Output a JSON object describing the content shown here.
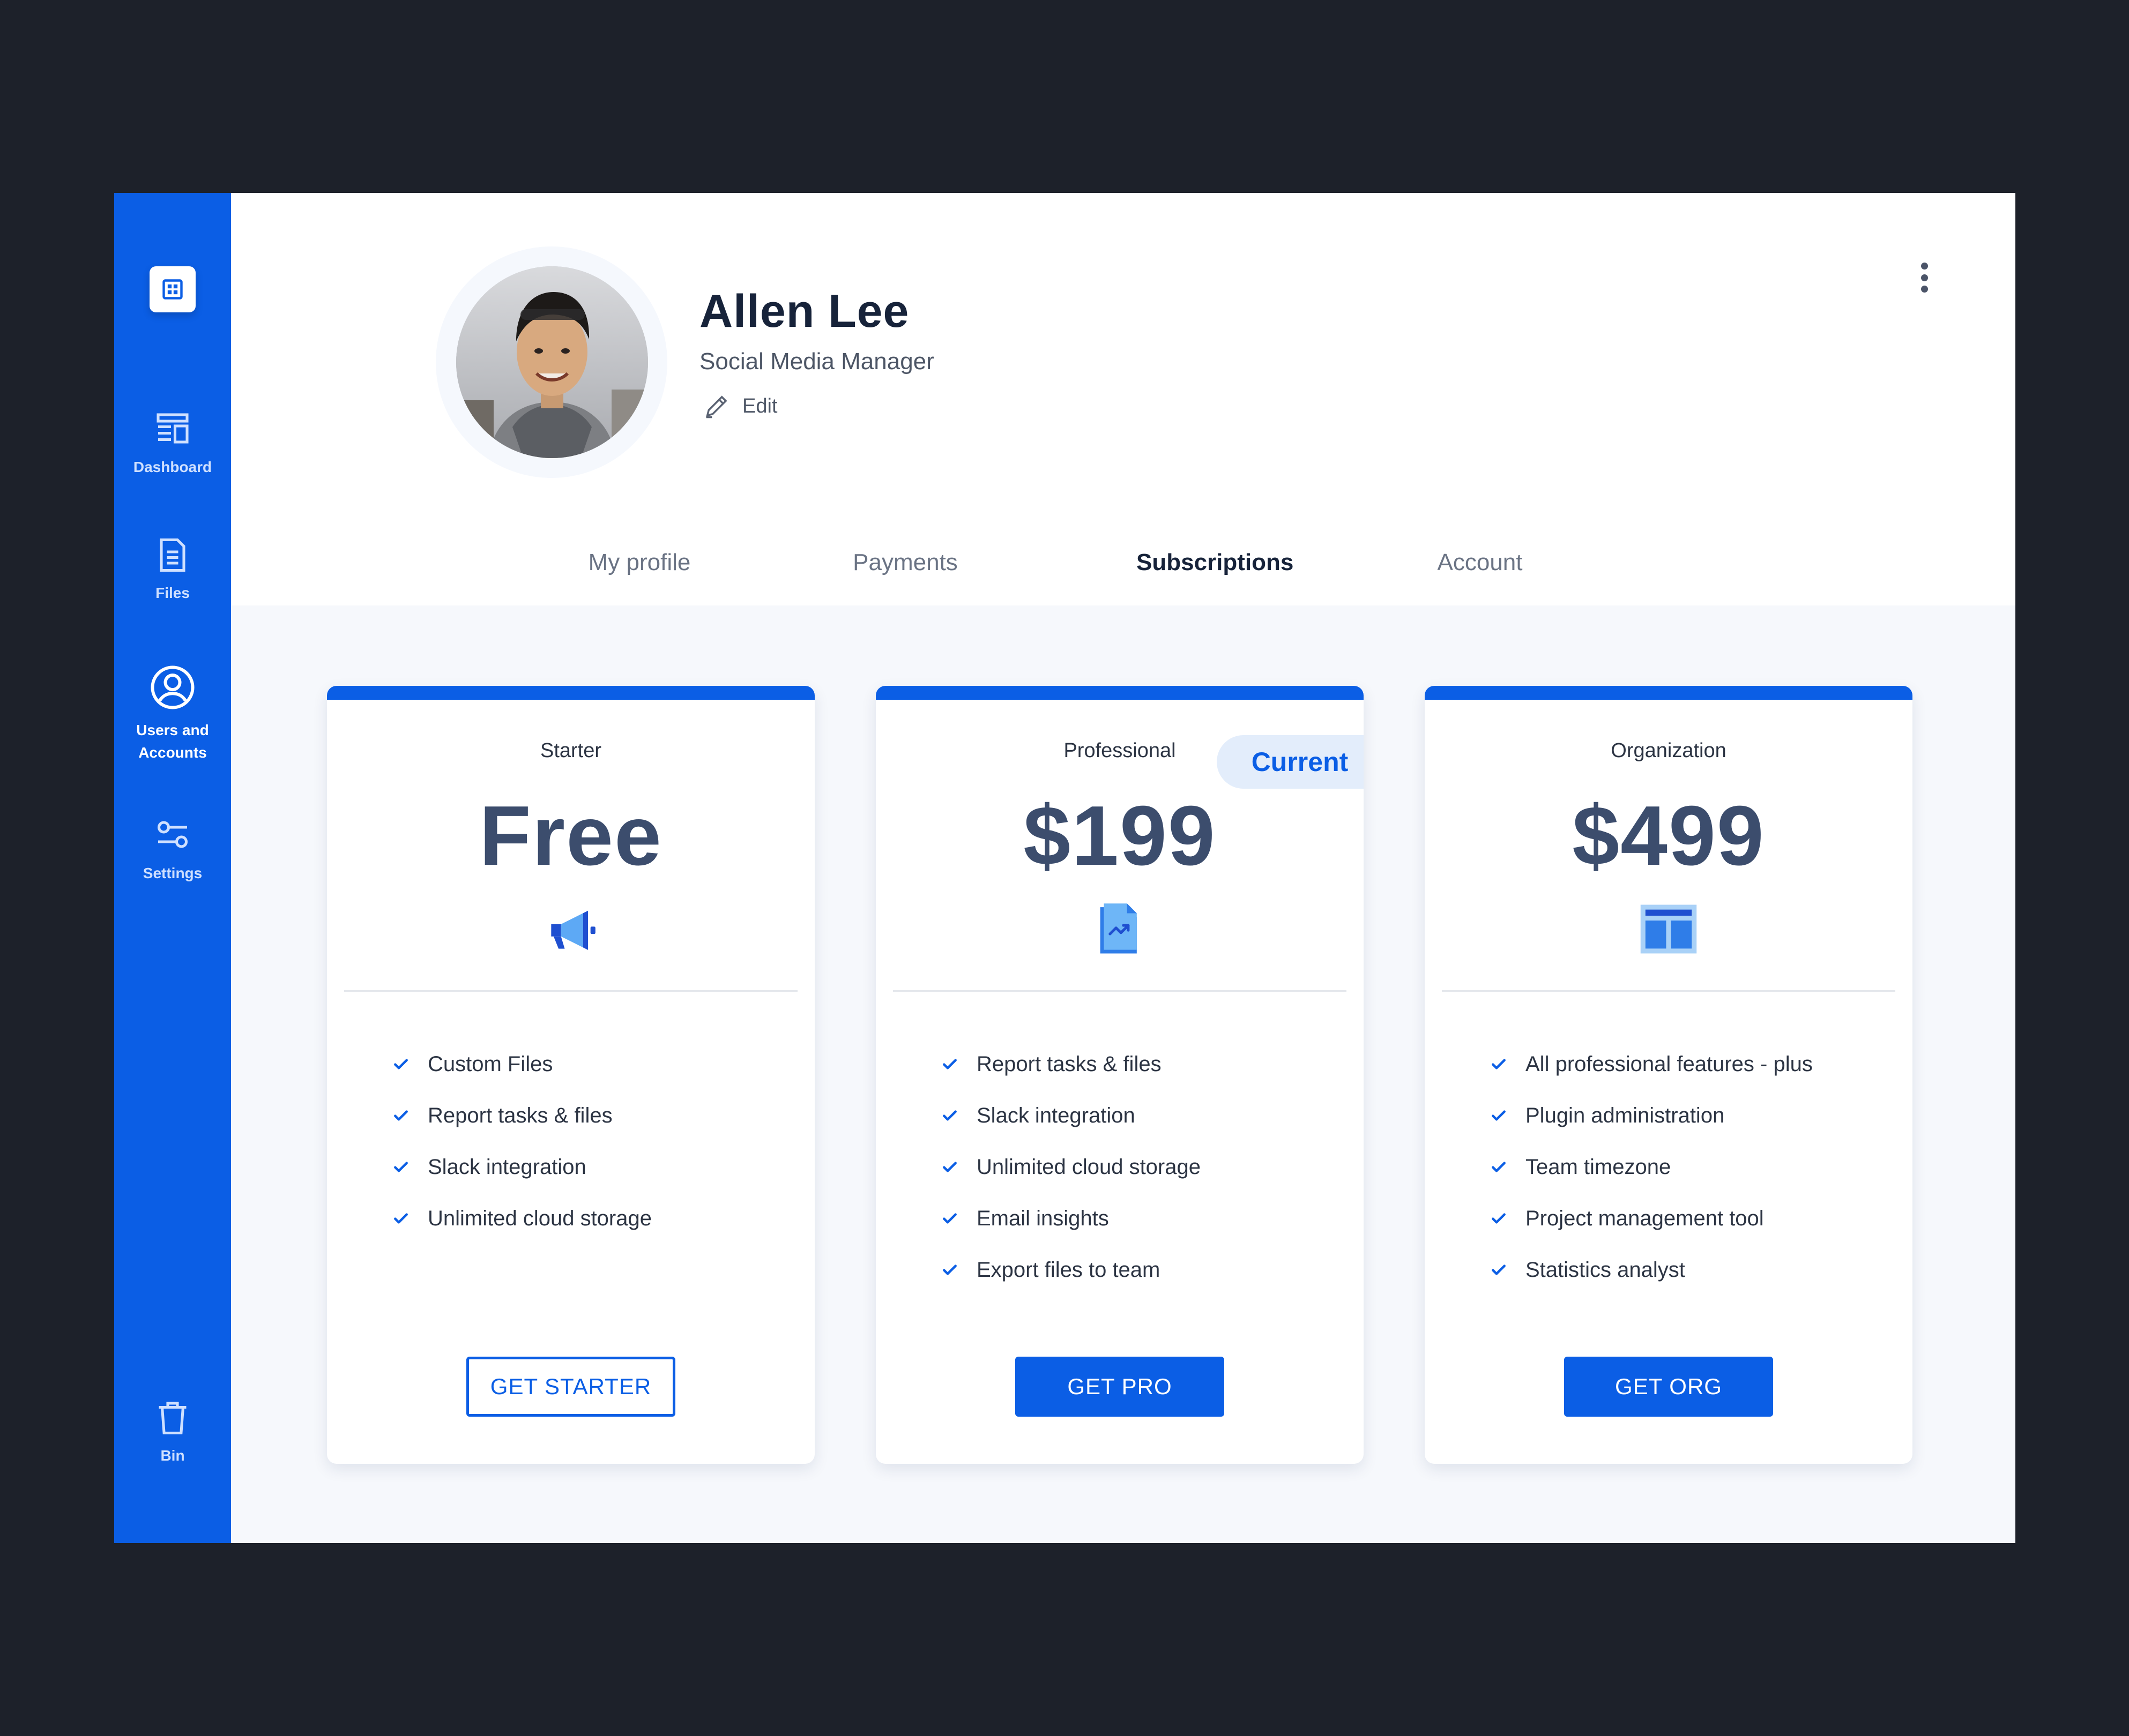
{
  "sidebar": {
    "logo_icon": "grid-logo-icon",
    "items": [
      {
        "label": "Dashboard",
        "icon": "dashboard-icon"
      },
      {
        "label": "Files",
        "icon": "file-icon"
      },
      {
        "label": "Users and Accounts",
        "icon": "user-circle-icon",
        "active": true
      },
      {
        "label": "Settings",
        "icon": "sliders-icon"
      },
      {
        "label": "Bin",
        "icon": "trash-icon"
      }
    ]
  },
  "profile": {
    "name": "Allen Lee",
    "role": "Social Media Manager",
    "edit_label": "Edit"
  },
  "tabs": [
    {
      "label": "My profile"
    },
    {
      "label": "Payments"
    },
    {
      "label": "Subscriptions",
      "active": true
    },
    {
      "label": "Account"
    }
  ],
  "plans": [
    {
      "name": "Starter",
      "price": "Free",
      "icon": "megaphone-icon",
      "features": [
        "Custom Files",
        "Report tasks & files",
        "Slack integration",
        "Unlimited cloud storage"
      ],
      "cta": "GET STARTER"
    },
    {
      "name": "Professional",
      "price": "$199",
      "icon": "report-chart-icon",
      "badge": "Current",
      "features": [
        "Report tasks & files",
        "Slack integration",
        "Unlimited cloud storage",
        "Email insights",
        "Export files to team"
      ],
      "cta": "GET PRO"
    },
    {
      "name": "Organization",
      "price": "$499",
      "icon": "layout-icon",
      "features": [
        "All professional features - plus",
        "Plugin administration",
        "Team timezone",
        "Project management tool",
        "Statistics analyst"
      ],
      "cta": "GET ORG"
    }
  ],
  "colors": {
    "accent": "#0b5ee5",
    "background": "#1d212a",
    "price_text": "#3c4d6d",
    "heading": "#17233a"
  }
}
